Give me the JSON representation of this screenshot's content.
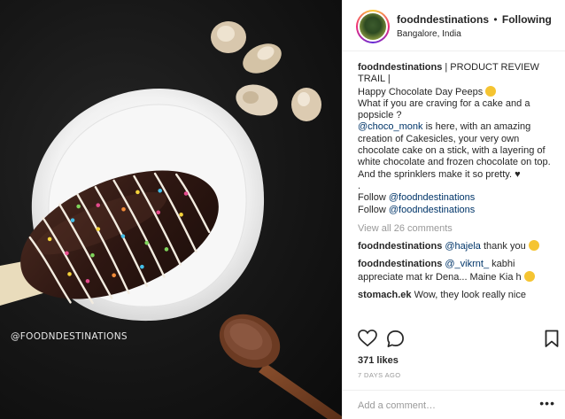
{
  "photo": {
    "watermark": "@FOODNDESTINATIONS"
  },
  "header": {
    "username": "foodndestinations",
    "separator": "•",
    "follow_status": "Following",
    "location": "Bangalore, India"
  },
  "caption": {
    "username": "foodndestinations",
    "line1": "| PRODUCT REVIEW TRAIL |",
    "line2": "Happy Chocolate Day Peeps",
    "line3": "What if you are craving for a cake and a popsicle ?",
    "mention": "@choco_monk",
    "line4": "is here, with an amazing creation of Cakesicles, your very own chocolate cake on a stick, with a layering of white chocolate and frozen chocolate on top. And the sprinklers make it so pretty.",
    "heart": "♥",
    "dot": ".",
    "follow1_prefix": "Follow",
    "follow1_handle": "@foodndestinations",
    "follow2_prefix": "Follow",
    "follow2_handle": "@foodndestinations"
  },
  "view_all_comments": "View all 26 comments",
  "comments": [
    {
      "user": "foodndestinations",
      "mention": "@hajela",
      "text": "thank you"
    },
    {
      "user": "foodndestinations",
      "mention": "@_vikrnt_",
      "text": "kabhi appreciate mat kr Dena... Maine Kia h"
    },
    {
      "user": "stomach.ek",
      "mention": "",
      "text": "Wow, they look really nice"
    }
  ],
  "likes": "371 likes",
  "date": "7 DAYS AGO",
  "add_comment_placeholder": "Add a comment…",
  "more_options": "•••",
  "icons": {
    "like": "heart-outline-icon",
    "comment": "speech-bubble-icon",
    "save": "bookmark-icon"
  }
}
